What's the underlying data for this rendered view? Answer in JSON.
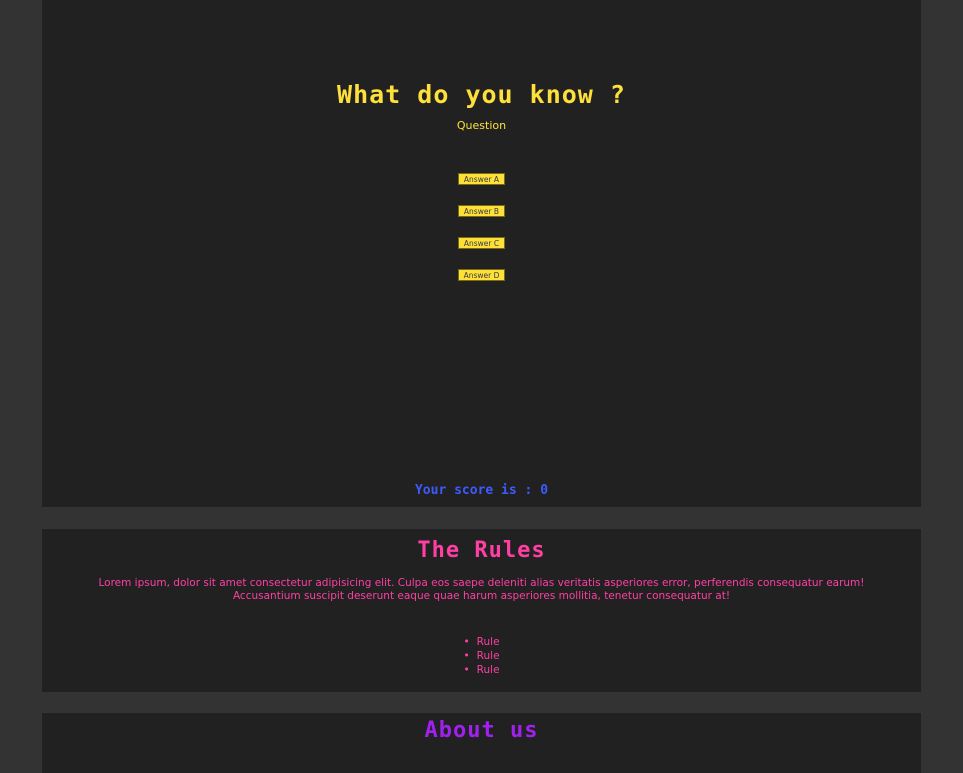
{
  "quiz": {
    "title": "What do you know ?",
    "question": "Question",
    "answers": [
      "Answer A",
      "Answer B",
      "Answer C",
      "Answer D"
    ],
    "score_label": "Your score is : 0"
  },
  "rules": {
    "title": "The Rules",
    "body": "Lorem ipsum, dolor sit amet consectetur adipisicing elit. Culpa eos saepe deleniti alias veritatis asperiores error, perferendis consequatur earum! Accusantium suscipit deserunt eaque quae harum asperiores mollitia, tenetur consequatur at!",
    "items": [
      "Rule",
      "Rule",
      "Rule"
    ]
  },
  "about": {
    "title": "About us"
  },
  "colors": {
    "page_bg": "#333333",
    "panel_bg": "#212121",
    "quiz_accent": "#fde03a",
    "score_color": "#3d5afe",
    "rules_color": "#ff3fa4",
    "about_color": "#a020f0"
  }
}
